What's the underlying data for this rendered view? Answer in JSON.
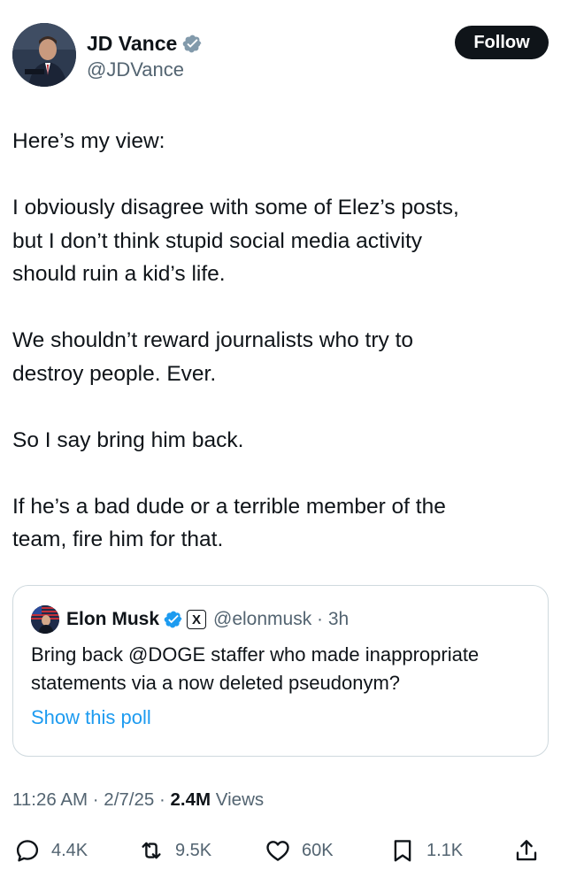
{
  "author": {
    "display_name": "JD Vance",
    "handle": "@JDVance",
    "verified_icon": "verified-badge-gray"
  },
  "follow_label": "Follow",
  "tweet": {
    "lines": [
      "Here’s my view:",
      "",
      "I obviously disagree with some of Elez’s posts,",
      "but I don’t think stupid social media activity",
      "should ruin a kid’s life.",
      "",
      "We shouldn’t reward journalists who try to",
      "destroy people. Ever.",
      "",
      "So I say bring him back.",
      "",
      "If he’s a bad dude or a terrible member of the",
      "team, fire him for that."
    ]
  },
  "quote": {
    "display_name": "Elon Musk",
    "handle_time": "@elonmusk · 3h",
    "x_badge": "X",
    "text_line1": "Bring back @DOGE staffer who made inappropriate",
    "text_line2": "statements via a now deleted pseudonym?",
    "poll_link": "Show this poll"
  },
  "meta": {
    "time_date": "11:26 AM · 2/7/25 · ",
    "views_count": "2.4M",
    "views_label": " Views"
  },
  "actions": {
    "replies": "4.4K",
    "reposts": "9.5K",
    "likes": "60K",
    "bookmarks": "1.1K"
  },
  "colors": {
    "text": "#0f1419",
    "secondary": "#536471",
    "link": "#1d9bf0",
    "verified_blue": "#1d9bf0",
    "verified_gray": "#829aab",
    "border": "#cfd9de"
  }
}
